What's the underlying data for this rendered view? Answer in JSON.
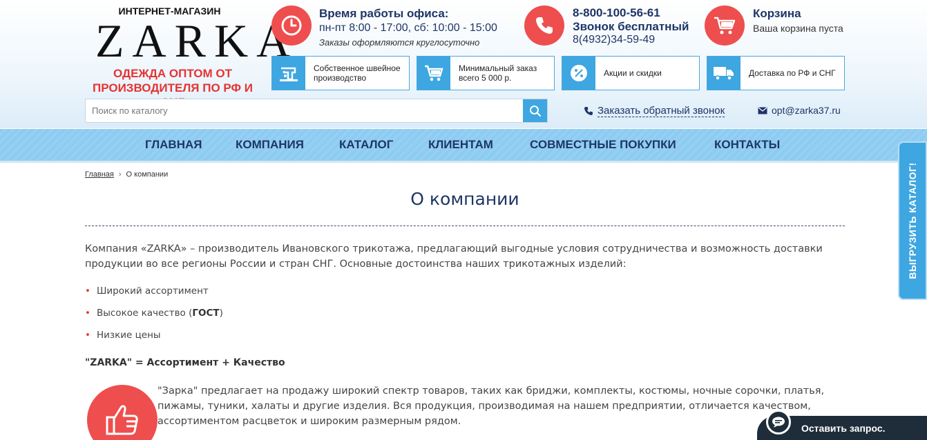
{
  "logo": {
    "top": "ИНТЕРНЕТ-МАГАЗИН",
    "word": "ZARKA",
    "tagline": "ОДЕЖДА ОПТОМ ОТ ПРОИЗВОДИТЕЛЯ ПО РФ И СНГ"
  },
  "office": {
    "icon": "clock-icon",
    "title": "Время работы офиса:",
    "hours": "пн-пт 8:00 - 17:00, сб: 10:00 - 15:00",
    "note": "Заказы оформляются круглосуточно"
  },
  "phone": {
    "icon": "phone-icon",
    "number": "8-800-100-56-61",
    "free": "Звонок бесплатный",
    "alt": "8(4932)34-59-49"
  },
  "cart": {
    "icon": "cart-icon",
    "title": "Корзина",
    "status": "Ваша корзина пуста"
  },
  "features": [
    {
      "icon": "sewing-machine-icon",
      "text": "Собственное швейное производство"
    },
    {
      "icon": "basket-icon",
      "text": "Минимальный заказ всего 5 000 р."
    },
    {
      "icon": "percent-icon",
      "text": "Акции и скидки"
    },
    {
      "icon": "truck-icon",
      "text": "Доставка по РФ и СНГ"
    }
  ],
  "search": {
    "placeholder": "Поиск по каталогу"
  },
  "callback": {
    "label": "Заказать обратный звонок"
  },
  "email": {
    "label": "opt@zarka37.ru"
  },
  "nav": [
    "ГЛАВНАЯ",
    "КОМПАНИЯ",
    "КАТАЛОГ",
    "КЛИЕНТАМ",
    "СОВМЕСТНЫЕ ПОКУПКИ",
    "КОНТАКТЫ"
  ],
  "breadcrumb": {
    "home": "Главная",
    "current": "О компании"
  },
  "page": {
    "title": "О компании",
    "intro": "Компания «ZARKA» – производитель Ивановского трикотажа, предлагающий выгодные условия сотрудничества и возможность доставки продукции во все регионы России и стран СНГ. Основные достоинства наших трикотажных изделий:",
    "bullets": {
      "b1": "Широкий ассортимент",
      "b2_pre": "Высокое качество (",
      "b2_bold": "ГОСТ",
      "b2_post": ")",
      "b3": "Низкие цены"
    },
    "subhead": "\"ZARKA\" = Ассортимент + Качество",
    "para": "\"Зарка\" предлагает на продажу широкий спектр товаров, таких как бриджи, комплекты, костюмы, ночные сорочки, платья, пижамы, туники, халаты и другие изделия. Вся продукция, производимая на нашем предприятии, отличается качеством, ассортиментом расцветок и широким размерным рядом."
  },
  "side_tab": {
    "label": "ВЫГРУЗИТЬ КАТАЛОГ!"
  },
  "request": {
    "label": "Оставить запрос."
  },
  "colors": {
    "accent_red": "#ee4e4e",
    "accent_blue": "#3ea6e0",
    "navy": "#1e3566",
    "nav_bg": "#8dcbf1"
  }
}
